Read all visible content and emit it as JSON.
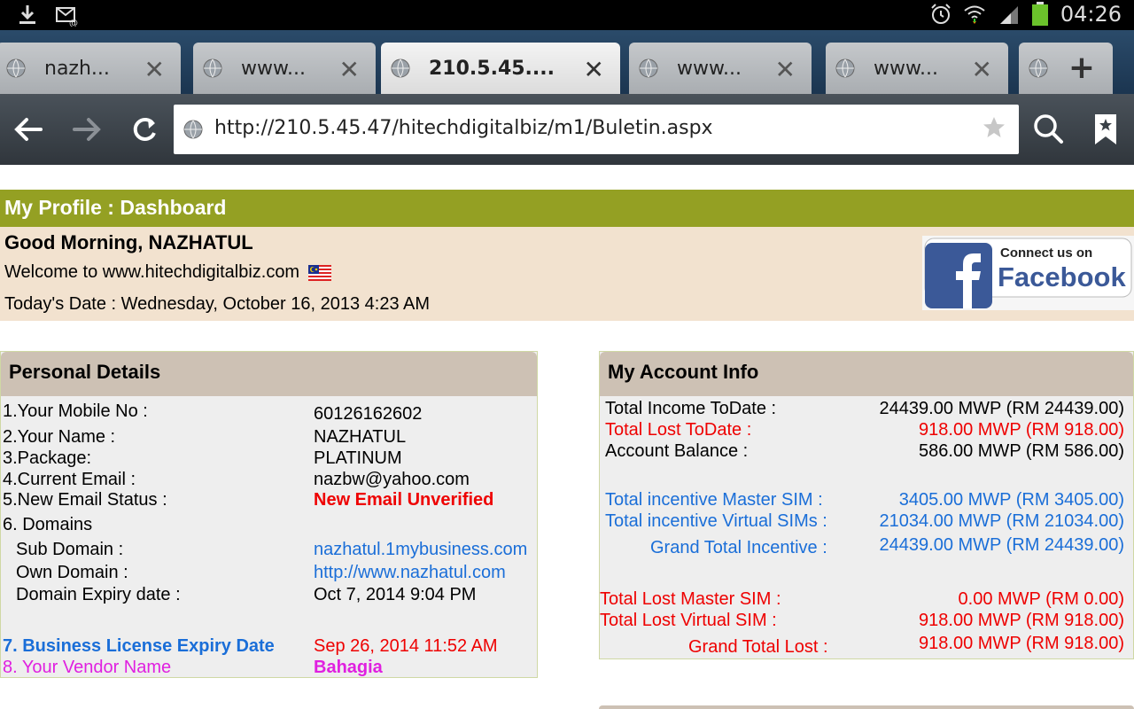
{
  "status_bar": {
    "time": "04:26",
    "left_icons": [
      "download-icon",
      "email-icon"
    ],
    "right_icons": [
      "alarm-icon",
      "wifi-icon",
      "signal-icon",
      "battery-icon"
    ]
  },
  "tabs": [
    {
      "title": "nazh...",
      "active": false
    },
    {
      "title": "www...",
      "active": false
    },
    {
      "title": "210.5.45....",
      "active": true
    },
    {
      "title": "www...",
      "active": false
    },
    {
      "title": "www...",
      "active": false
    }
  ],
  "toolbar": {
    "url": "http://210.5.45.47/hitechdigitalbiz/m1/Buletin.aspx"
  },
  "dashboard": {
    "title": "My Profile : Dashboard",
    "greeting": "Good Morning, NAZHATUL",
    "welcome": "Welcome to www.hitechdigitalbiz.com",
    "date": "Today's Date : Wednesday, October 16, 2013  4:23 AM",
    "facebook": {
      "line1": "Connect us on",
      "line2": "Facebook"
    }
  },
  "personal": {
    "title": "Personal Details",
    "rows": {
      "mobile_label": "1.Your Mobile No :",
      "mobile_value": "60126162602",
      "name_label": "2.Your Name :",
      "name_value": "NAZHATUL",
      "package_label": "3.Package:",
      "package_value": "PLATINUM",
      "email_label": "4.Current Email :",
      "email_value": "nazbw@yahoo.com",
      "status_label": "5.New Email Status :",
      "status_value": "New Email Unverified",
      "domains_label": "6. Domains",
      "sub_label": "Sub Domain :",
      "sub_value": "nazhatul.1mybusiness.com",
      "own_label": "Own Domain :",
      "own_value": "http://www.nazhatul.com",
      "expiry_label": "Domain Expiry date :",
      "expiry_value": "Oct 7, 2014 9:04 PM",
      "license_label": "7. Business License Expiry Date",
      "license_value": "Sep 26, 2014 11:52 AM",
      "vendor_label": "8. Your Vendor Name",
      "vendor_value": "Bahagia"
    }
  },
  "account": {
    "title": "My Account Info",
    "rows": {
      "income_label": "Total Income ToDate :",
      "income_value": "24439.00 MWP (RM 24439.00)",
      "lost_label": "Total Lost ToDate :",
      "lost_value": "918.00 MWP (RM 918.00)",
      "balance_label": "Account Balance :",
      "balance_value": "586.00 MWP (RM 586.00)",
      "master_label": "Total incentive Master SIM :",
      "master_value": "3405.00 MWP (RM 3405.00)",
      "virtual_label": "Total incentive Virtual SIMs :",
      "virtual_value": "21034.00 MWP (RM 21034.00)",
      "grand_label": "Grand Total Incentive :",
      "grand_value": "24439.00 MWP (RM 24439.00)",
      "lost_master_label": "Total Lost Master SIM :",
      "lost_master_value": "0.00 MWP (RM 0.00)",
      "lost_virtual_label": "Total Lost Virtual SIM :",
      "lost_virtual_value": "918.00 MWP (RM 918.00)",
      "grand_lost_label": "Grand Total Lost :",
      "grand_lost_value": "918.00 MWP (RM 918.00)"
    }
  }
}
